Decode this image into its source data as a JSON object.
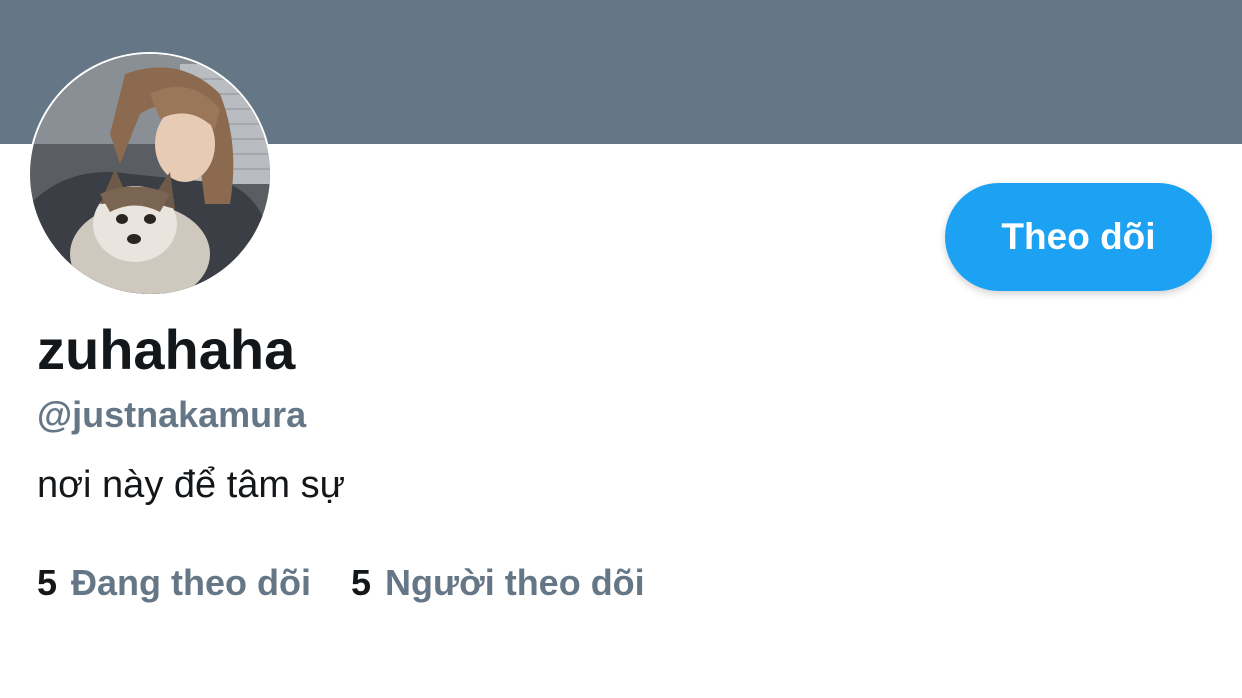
{
  "profile": {
    "display_name": "zuhahaha",
    "handle": "@justnakamura",
    "bio": "nơi này để tâm sự",
    "follow_button_label": "Theo dõi",
    "stats": {
      "following_count": "5",
      "following_label": "Đang theo dõi",
      "followers_count": "5",
      "followers_label": "Người theo dõi"
    }
  },
  "colors": {
    "banner": "#657786",
    "accent": "#1da1f2",
    "text_primary": "#14171a",
    "text_secondary": "#657786"
  },
  "icons": {
    "avatar": "profile-photo"
  }
}
